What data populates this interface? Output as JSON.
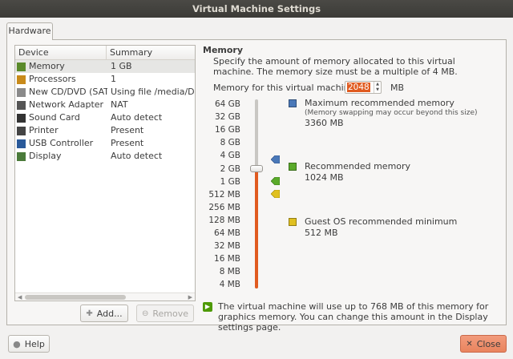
{
  "window": {
    "title": "Virtual Machine Settings"
  },
  "tabs": [
    {
      "label": "Hardware"
    }
  ],
  "devices": {
    "headers": {
      "device": "Device",
      "summary": "Summary"
    },
    "rows": [
      {
        "device": "Memory",
        "summary": "1 GB",
        "icon": "memory-icon",
        "color": "#5a8a2a",
        "selected": true
      },
      {
        "device": "Processors",
        "summary": "1",
        "icon": "cpu-icon",
        "color": "#c88a1a",
        "selected": false
      },
      {
        "device": "New CD/DVD (SATA)",
        "summary": "Using file /media/Dade",
        "icon": "cd-icon",
        "color": "#8a8a8a",
        "selected": false
      },
      {
        "device": "Network Adapter",
        "summary": "NAT",
        "icon": "network-icon",
        "color": "#555555",
        "selected": false
      },
      {
        "device": "Sound Card",
        "summary": "Auto detect",
        "icon": "speaker-icon",
        "color": "#333333",
        "selected": false
      },
      {
        "device": "Printer",
        "summary": "Present",
        "icon": "printer-icon",
        "color": "#444444",
        "selected": false
      },
      {
        "device": "USB Controller",
        "summary": "Present",
        "icon": "usb-icon",
        "color": "#2a5a9a",
        "selected": false
      },
      {
        "device": "Display",
        "summary": "Auto detect",
        "icon": "display-icon",
        "color": "#4a7a3a",
        "selected": false
      }
    ],
    "add_label": "Add...",
    "remove_label": "Remove"
  },
  "memory": {
    "title": "Memory",
    "description": "Specify the amount of memory allocated to this virtual machine. The memory size must be a multiple of 4 MB.",
    "field_label": "Memory for this virtual machine:",
    "value": "2048",
    "unit": "MB",
    "scale": [
      "64 GB",
      "32 GB",
      "16 GB",
      "8 GB",
      "4 GB",
      "2 GB",
      "1 GB",
      "512 MB",
      "256 MB",
      "128 MB",
      "64 MB",
      "32 MB",
      "16 MB",
      "8 MB",
      "4 MB"
    ],
    "legend": {
      "max": {
        "title": "Maximum recommended memory",
        "note": "(Memory swapping may occur beyond this size)",
        "value": "3360 MB",
        "color": "#4a78b8"
      },
      "recommended": {
        "title": "Recommended memory",
        "value": "1024 MB",
        "color": "#5aaa2a"
      },
      "guest_min": {
        "title": "Guest OS recommended minimum",
        "value": "512 MB",
        "color": "#e0c020"
      }
    },
    "info": "The virtual machine will use up to 768 MB of this memory for graphics memory. You can change this amount in the Display settings page."
  },
  "footer": {
    "help_label": "Help",
    "close_label": "Close"
  },
  "colors": {
    "accent": "#e05b20",
    "selection": "#e6e6e4"
  }
}
